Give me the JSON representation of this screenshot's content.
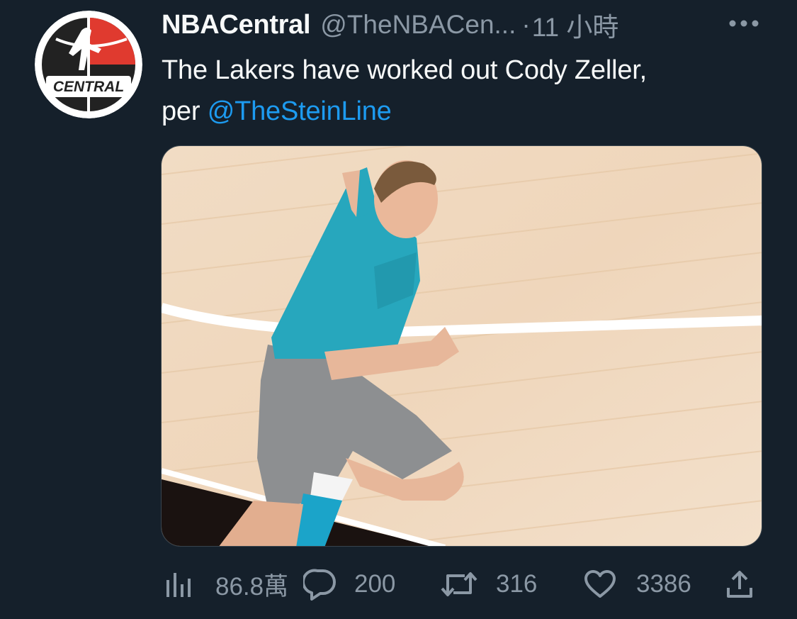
{
  "author": {
    "display_name": "NBACentral",
    "handle": "@TheNBACen...",
    "separator": "·",
    "time": "11 小時",
    "avatar_text": "CENTRAL"
  },
  "tweet": {
    "text_main": "The Lakers have worked out Cody Zeller,",
    "text_prefix": "per ",
    "mention": "@TheSteinLine"
  },
  "media": {
    "alt": "Basketball player in a teal Hornets warm-up shirt and gray shorts running on a hardwood court"
  },
  "actions": {
    "views": "86.8萬",
    "replies": "200",
    "retweets": "316",
    "likes": "3386"
  },
  "colors": {
    "background": "#15202b",
    "text_primary": "#f7f9f9",
    "text_secondary": "#8b98a5",
    "link": "#1d9bf0"
  },
  "icons": {
    "more": "more-horizontal-icon",
    "views": "views-bar-chart-icon",
    "reply": "reply-bubble-icon",
    "retweet": "retweet-icon",
    "like": "heart-icon",
    "share": "share-upload-icon"
  }
}
